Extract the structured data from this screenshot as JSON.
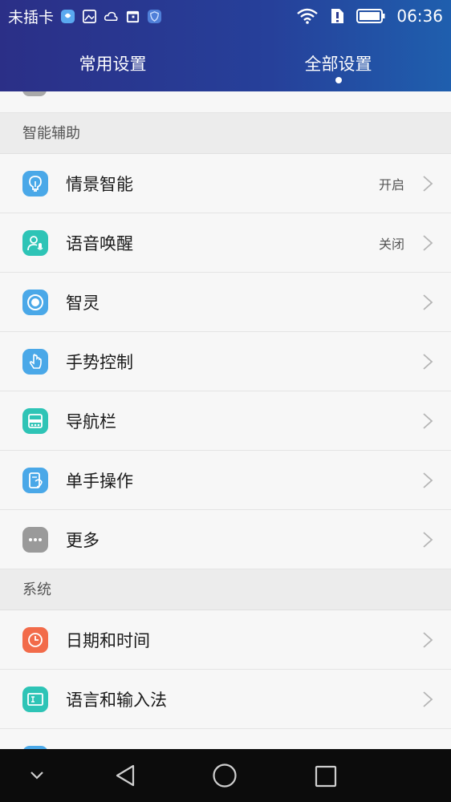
{
  "status_bar": {
    "carrier": "未插卡",
    "time": "06:36",
    "icons": [
      "notification-app-icon",
      "gallery-icon",
      "weather-icon",
      "calendar-icon",
      "shield-icon",
      "wifi-icon",
      "sim-alert-icon",
      "battery-icon"
    ]
  },
  "tabs": [
    {
      "label": "常用设置",
      "active": false
    },
    {
      "label": "全部设置",
      "active": true
    }
  ],
  "sections": {
    "assist": {
      "title": "智能辅助",
      "items": [
        {
          "label": "情景智能",
          "value": "开启",
          "icon": "lightbulb-icon",
          "color": "#4aa8e8"
        },
        {
          "label": "语音唤醒",
          "value": "关闭",
          "icon": "voice-user-icon",
          "color": "#2ec4b6"
        },
        {
          "label": "智灵",
          "icon": "record-circle-icon",
          "color": "#4aa8e8"
        },
        {
          "label": "手势控制",
          "icon": "gesture-hand-icon",
          "color": "#4aa8e8"
        },
        {
          "label": "导航栏",
          "icon": "navbar-icon",
          "color": "#2ec4b6"
        },
        {
          "label": "单手操作",
          "icon": "one-hand-icon",
          "color": "#4aa8e8"
        },
        {
          "label": "更多",
          "icon": "more-dots-icon",
          "color": "#9a9a9a"
        }
      ]
    },
    "system": {
      "title": "系统",
      "items": [
        {
          "label": "日期和时间",
          "icon": "clock-icon",
          "color": "#f26b4a"
        },
        {
          "label": "语言和输入法",
          "icon": "keyboard-icon",
          "color": "#2ec4b6"
        }
      ]
    }
  }
}
